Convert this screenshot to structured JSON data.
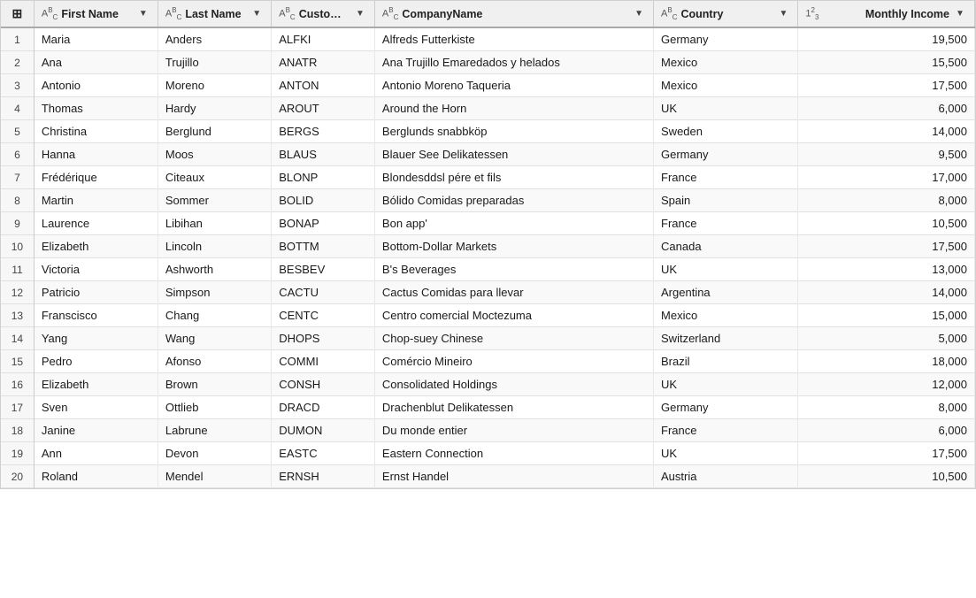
{
  "colors": {
    "header_bg": "#f0f0f0",
    "row_odd": "#ffffff",
    "row_even": "#f9f9f9",
    "border": "#d0d0d0"
  },
  "table": {
    "grid_icon": "⊞",
    "columns": [
      {
        "id": "row",
        "label": "",
        "type": "",
        "has_filter": false
      },
      {
        "id": "fname",
        "label": "First Name",
        "type": "ABC",
        "has_filter": true
      },
      {
        "id": "lname",
        "label": "Last Name",
        "type": "ABC",
        "has_filter": true
      },
      {
        "id": "cid",
        "label": "CustomerID",
        "type": "ABC",
        "has_filter": true
      },
      {
        "id": "comp",
        "label": "CompanyName",
        "type": "ABC",
        "has_filter": true
      },
      {
        "id": "ctry",
        "label": "Country",
        "type": "ABC",
        "has_filter": true
      },
      {
        "id": "inc",
        "label": "Monthly Income",
        "type": "123",
        "has_filter": true
      }
    ],
    "rows": [
      {
        "num": 1,
        "fname": "Maria",
        "lname": "Anders",
        "cid": "ALFKI",
        "comp": "Alfreds Futterkiste",
        "ctry": "Germany",
        "inc": 19500
      },
      {
        "num": 2,
        "fname": "Ana",
        "lname": "Trujillo",
        "cid": "ANATR",
        "comp": "Ana Trujillo Emaredados y helados",
        "ctry": "Mexico",
        "inc": 15500
      },
      {
        "num": 3,
        "fname": "Antonio",
        "lname": "Moreno",
        "cid": "ANTON",
        "comp": "Antonio Moreno Taqueria",
        "ctry": "Mexico",
        "inc": 17500
      },
      {
        "num": 4,
        "fname": "Thomas",
        "lname": "Hardy",
        "cid": "AROUT",
        "comp": "Around the Horn",
        "ctry": "UK",
        "inc": 6000
      },
      {
        "num": 5,
        "fname": "Christina",
        "lname": "Berglund",
        "cid": "BERGS",
        "comp": "Berglunds snabbköp",
        "ctry": "Sweden",
        "inc": 14000
      },
      {
        "num": 6,
        "fname": "Hanna",
        "lname": "Moos",
        "cid": "BLAUS",
        "comp": "Blauer See Delikatessen",
        "ctry": "Germany",
        "inc": 9500
      },
      {
        "num": 7,
        "fname": "Frédérique",
        "lname": "Citeaux",
        "cid": "BLONP",
        "comp": "Blondesddsl pére et fils",
        "ctry": "France",
        "inc": 17000
      },
      {
        "num": 8,
        "fname": "Martin",
        "lname": "Sommer",
        "cid": "BOLID",
        "comp": "Bólido Comidas preparadas",
        "ctry": "Spain",
        "inc": 8000
      },
      {
        "num": 9,
        "fname": "Laurence",
        "lname": "Libihan",
        "cid": "BONAP",
        "comp": "Bon app'",
        "ctry": "France",
        "inc": 10500
      },
      {
        "num": 10,
        "fname": "Elizabeth",
        "lname": "Lincoln",
        "cid": "BOTTM",
        "comp": "Bottom-Dollar Markets",
        "ctry": "Canada",
        "inc": 17500
      },
      {
        "num": 11,
        "fname": "Victoria",
        "lname": "Ashworth",
        "cid": "BESBEV",
        "comp": "B's Beverages",
        "ctry": "UK",
        "inc": 13000
      },
      {
        "num": 12,
        "fname": "Patricio",
        "lname": "Simpson",
        "cid": "CACTU",
        "comp": "Cactus Comidas para llevar",
        "ctry": "Argentina",
        "inc": 14000
      },
      {
        "num": 13,
        "fname": "Franscisco",
        "lname": "Chang",
        "cid": "CENTC",
        "comp": "Centro comercial Moctezuma",
        "ctry": "Mexico",
        "inc": 15000
      },
      {
        "num": 14,
        "fname": "Yang",
        "lname": "Wang",
        "cid": "DHOPS",
        "comp": "Chop-suey Chinese",
        "ctry": "Switzerland",
        "inc": 5000
      },
      {
        "num": 15,
        "fname": "Pedro",
        "lname": "Afonso",
        "cid": "COMMI",
        "comp": "Comércio Mineiro",
        "ctry": "Brazil",
        "inc": 18000
      },
      {
        "num": 16,
        "fname": "Elizabeth",
        "lname": "Brown",
        "cid": "CONSH",
        "comp": "Consolidated Holdings",
        "ctry": "UK",
        "inc": 12000
      },
      {
        "num": 17,
        "fname": "Sven",
        "lname": "Ottlieb",
        "cid": "DRACD",
        "comp": "Drachenblut Delikatessen",
        "ctry": "Germany",
        "inc": 8000
      },
      {
        "num": 18,
        "fname": "Janine",
        "lname": "Labrune",
        "cid": "DUMON",
        "comp": "Du monde entier",
        "ctry": "France",
        "inc": 6000
      },
      {
        "num": 19,
        "fname": "Ann",
        "lname": "Devon",
        "cid": "EASTC",
        "comp": "Eastern Connection",
        "ctry": "UK",
        "inc": 17500
      },
      {
        "num": 20,
        "fname": "Roland",
        "lname": "Mendel",
        "cid": "ERNSH",
        "comp": "Ernst Handel",
        "ctry": "Austria",
        "inc": 10500
      }
    ]
  }
}
